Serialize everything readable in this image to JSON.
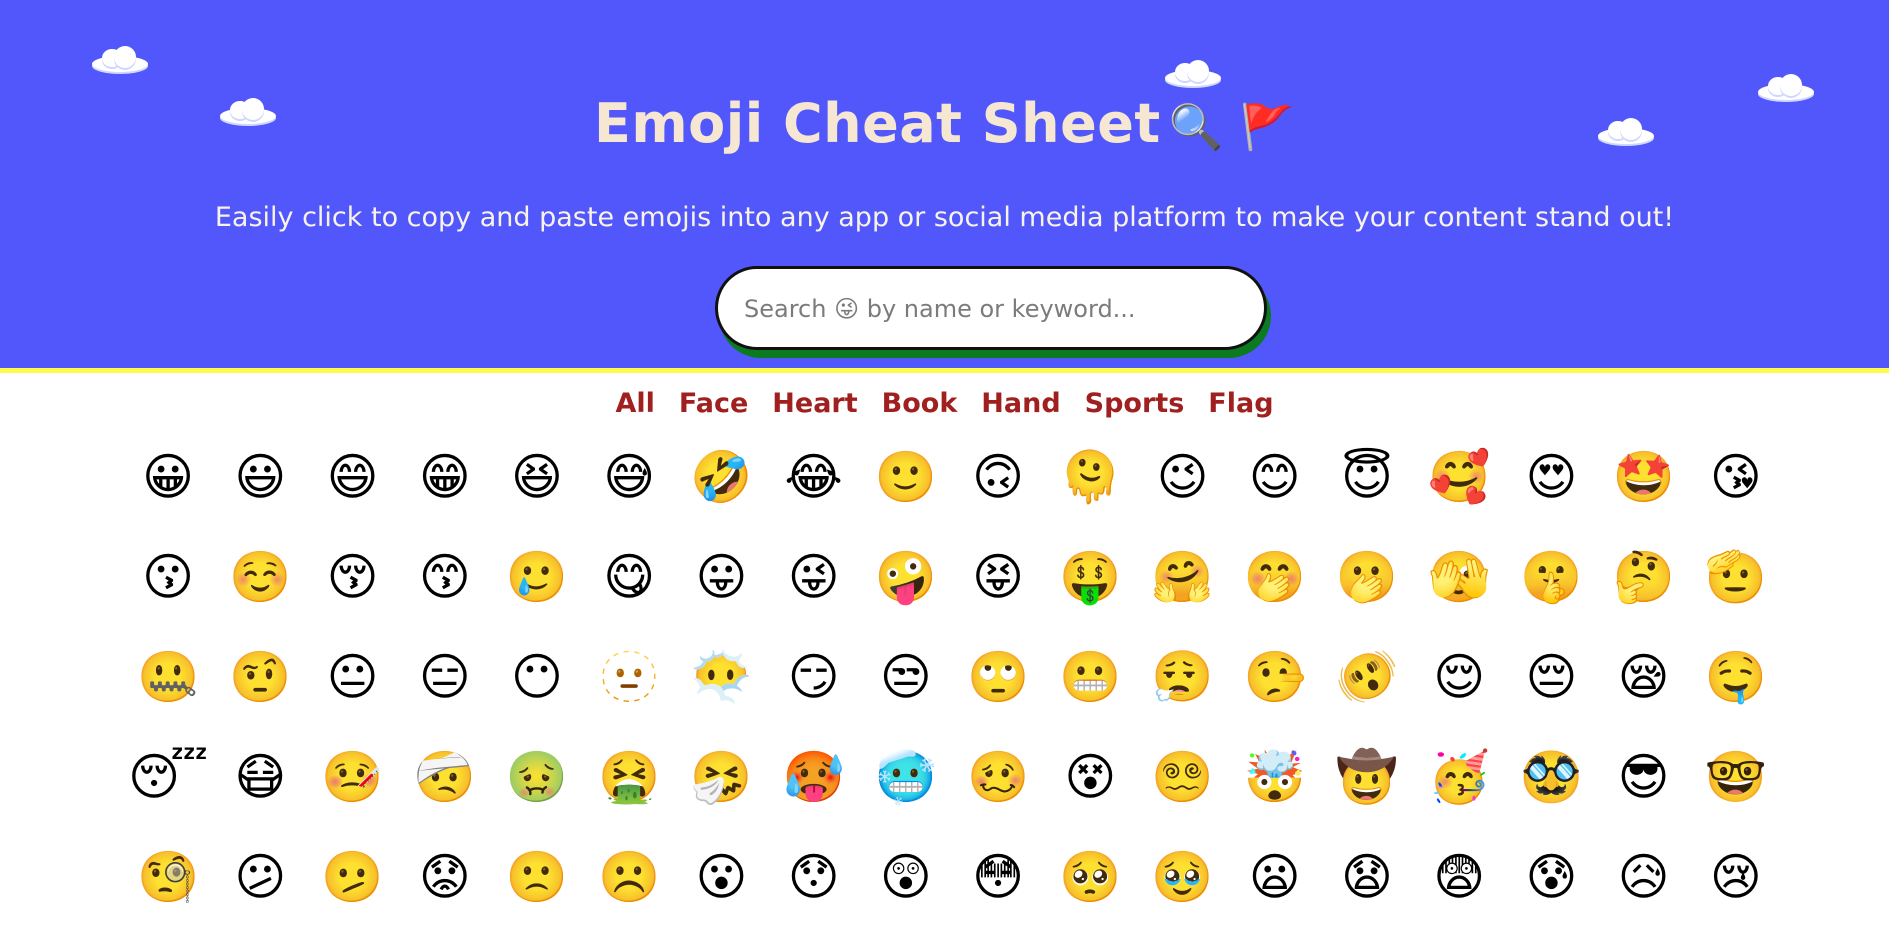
{
  "header": {
    "title": "Emoji Cheat Sheet",
    "title_emojis": "🔍 🚩",
    "subtitle": "Easily click to copy and paste emojis into any app or social media platform to make your content stand out!",
    "colors": {
      "background": "#5257fb",
      "title": "#f6e7d3",
      "accent_border": "#fffb4c"
    }
  },
  "search": {
    "placeholder": "Search 😜 by name or keyword...",
    "value": ""
  },
  "categories": [
    "All",
    "Face",
    "Heart",
    "Book",
    "Hand",
    "Sports",
    "Flag"
  ],
  "emoji_rows": [
    [
      "😀",
      "😃",
      "😄",
      "😁",
      "😆",
      "😅",
      "🤣",
      "😂",
      "🙂",
      "🙃",
      "🫠",
      "😉",
      "😊",
      "😇",
      "🥰",
      "😍",
      "🤩",
      "😘"
    ],
    [
      "😗",
      "☺️",
      "😚",
      "😙",
      "🥲",
      "😋",
      "😛",
      "😜",
      "🤪",
      "😝",
      "🤑",
      "🤗",
      "🤭",
      "🫢",
      "🫣",
      "🤫",
      "🤔",
      "🫡"
    ],
    [
      "🤐",
      "🤨",
      "😐",
      "😑",
      "😶",
      "🫥",
      "😶‍🌫️",
      "😏",
      "😒",
      "🙄",
      "😬",
      "😮‍💨",
      "🤥",
      "🫨",
      "😌",
      "😔",
      "😪",
      "🤤"
    ],
    [
      "😴",
      "😷",
      "🤒",
      "🤕",
      "🤢",
      "🤮",
      "🤧",
      "🥵",
      "🥶",
      "🥴",
      "😵",
      "😵‍💫",
      "🤯",
      "🤠",
      "🥳",
      "🥸",
      "😎",
      "🤓"
    ],
    [
      "🧐",
      "😕",
      "🫤",
      "😟",
      "🙁",
      "☹️",
      "😮",
      "😯",
      "😲",
      "😳",
      "🥺",
      "🥹",
      "😦",
      "😧",
      "😨",
      "😰",
      "😥",
      "😢"
    ]
  ]
}
